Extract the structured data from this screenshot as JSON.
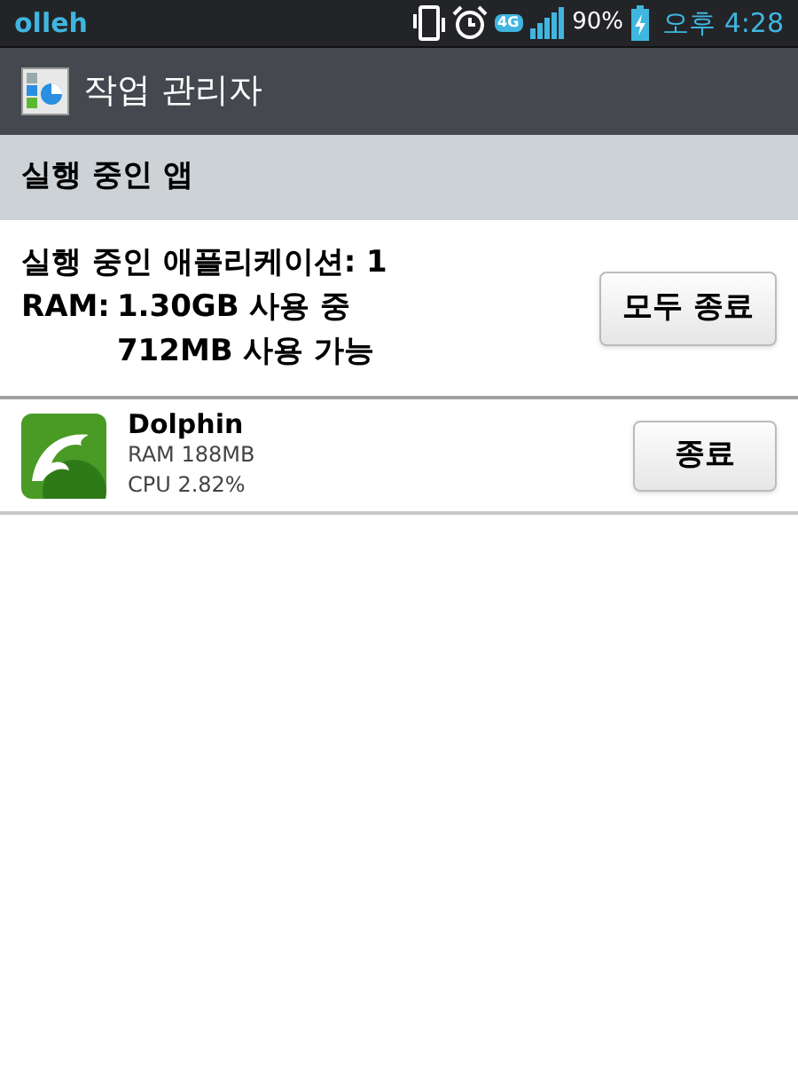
{
  "status_bar": {
    "carrier": "olleh",
    "network": "4G",
    "battery": "90%",
    "time": "오후 4:28"
  },
  "title_bar": {
    "title": "작업 관리자"
  },
  "section": {
    "title": "실행 중인 앱"
  },
  "summary": {
    "running": "실행 중인 애플리케이션: 1",
    "ram_label": "RAM:",
    "ram_used": "1.30GB 사용 중",
    "ram_free": "712MB 사용 가능",
    "button": "모두 종료"
  },
  "apps": [
    {
      "name": "Dolphin",
      "ram": "RAM 188MB",
      "cpu": "CPU 2.82%",
      "button": "종료"
    }
  ]
}
